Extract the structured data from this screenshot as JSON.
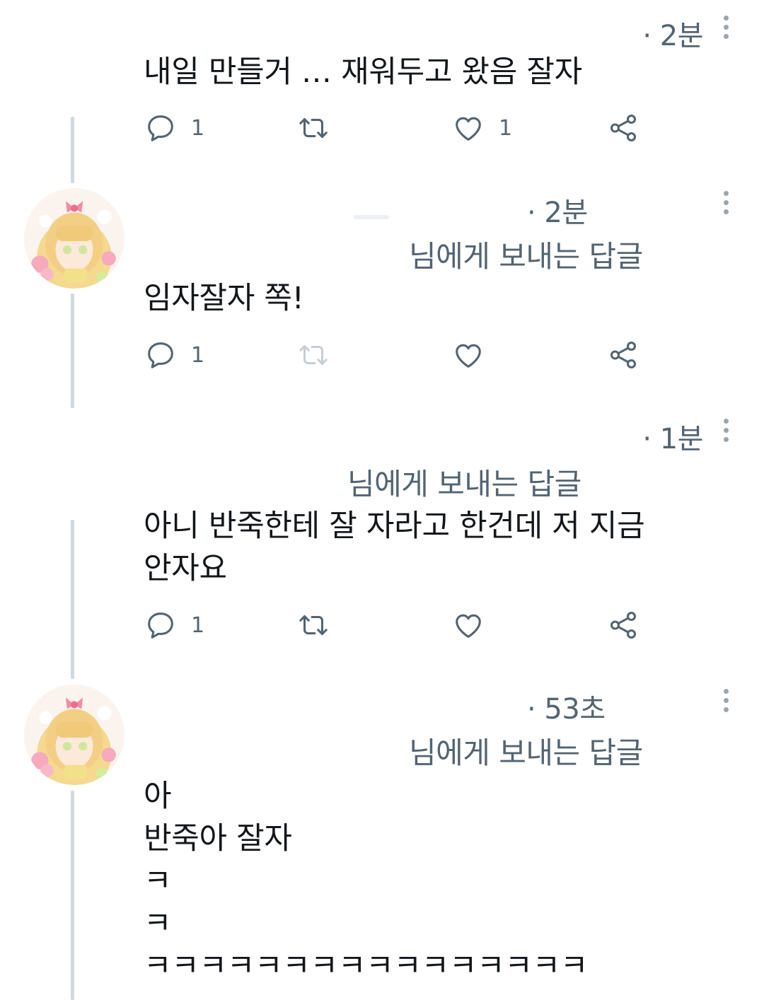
{
  "tweets": [
    {
      "time": "· 2분",
      "text": "내일 만들거 … 재워두고 왔음 잘자",
      "reply_count": "1",
      "like_count": "1"
    },
    {
      "time": "· 2분",
      "replying_to": "님에게 보내는 답글",
      "text": "임자잘자 쪽!",
      "reply_count": "1",
      "like_count": ""
    },
    {
      "time": "· 1분",
      "replying_to": "님에게 보내는 답글",
      "text": "아니 반죽한테 잘 자라고 한건데 저 지금\n안자요",
      "reply_count": "1",
      "like_count": ""
    },
    {
      "time": "· 53초",
      "replying_to": "님에게 보내는 답글",
      "text": "아\n반죽아 잘자\nㅋ\nㅋ\nㅋㅋㅋㅋㅋㅋㅋㅋㅋㅋㅋㅋㅋㅋㅋㅋ"
    }
  ],
  "icons": {
    "reply": "reply-icon",
    "retweet": "retweet-icon",
    "like": "heart-icon",
    "share": "share-icon",
    "more": "more-vertical-icon"
  },
  "colors": {
    "text": "#14171a",
    "secondary": "#536471",
    "thread_line": "#cfd9de",
    "icon": "#536471"
  }
}
